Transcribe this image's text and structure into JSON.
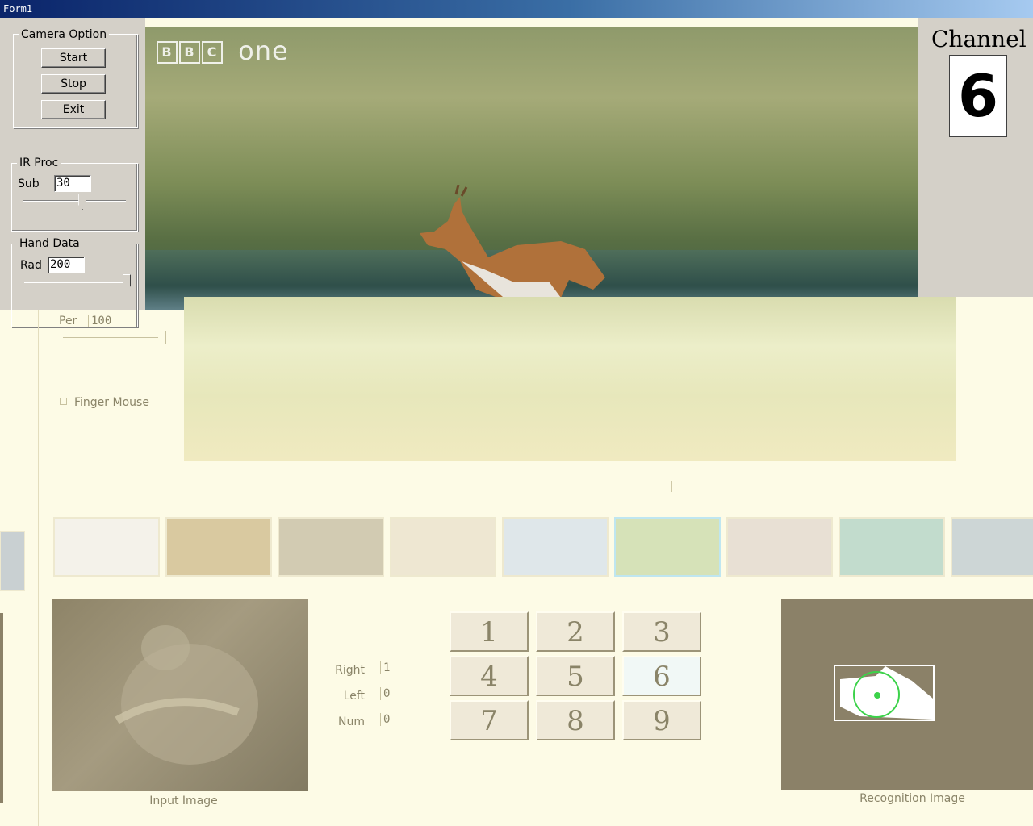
{
  "window": {
    "title": "Form1"
  },
  "camera_option": {
    "legend": "Camera Option",
    "start_label": "Start",
    "stop_label": "Stop",
    "exit_label": "Exit"
  },
  "ir_proc": {
    "legend": "IR Proc",
    "sub_label": "Sub",
    "sub_value": "30",
    "sub_slider_fraction": 0.58
  },
  "hand_data": {
    "legend": "Hand Data",
    "rad_label": "Rad",
    "rad_value": "200",
    "rad_slider_fraction": 0.98,
    "per_label": "Per",
    "per_value": "100",
    "finger_mouse_label": "Finger Mouse",
    "finger_mouse_checked": false
  },
  "video": {
    "logo_letters": [
      "B",
      "B",
      "C"
    ],
    "logo_word": "one"
  },
  "channel": {
    "title": "Channel",
    "value": "6"
  },
  "thumbnails": {
    "count": 9,
    "selected_index": 5,
    "colors": [
      "#f4f2ea",
      "#d9c9a0",
      "#d2cbb2",
      "#eee7d2",
      "#dfe7ea",
      "#d6e2b8",
      "#e8e0d4",
      "#c2dccd",
      "#cdd6d6"
    ]
  },
  "stats": {
    "right_label": "Right",
    "right_value": "1",
    "left_label": "Left",
    "left_value": "0",
    "num_label": "Num",
    "num_value": "0"
  },
  "keypad": {
    "keys": [
      "1",
      "2",
      "3",
      "4",
      "5",
      "6",
      "7",
      "8",
      "9"
    ],
    "active_key": "6"
  },
  "captions": {
    "input": "Input Image",
    "recognition": "Recognition Image"
  },
  "colors": {
    "titlebar": "#0a246a",
    "panel": "#d4d0c8",
    "faded_bg": "#fdfbe6",
    "recog_marker": "#3cd24a"
  }
}
